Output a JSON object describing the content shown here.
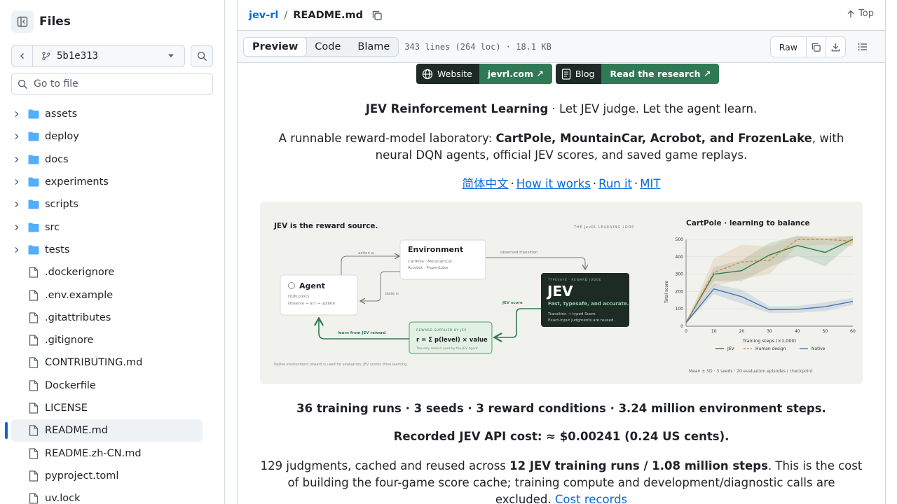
{
  "sidebar": {
    "title": "Files",
    "branch": "5b1e313",
    "goto_placeholder": "Go to file",
    "folders": [
      "assets",
      "deploy",
      "docs",
      "experiments",
      "scripts",
      "src",
      "tests"
    ],
    "files": [
      ".dockerignore",
      ".env.example",
      ".gitattributes",
      ".gitignore",
      "CONTRIBUTING.md",
      "Dockerfile",
      "LICENSE",
      "README.md",
      "README.zh-CN.md",
      "pyproject.toml",
      "uv.lock"
    ],
    "selected_file": "README.md"
  },
  "header": {
    "repo": "jev-rl",
    "separator": "/",
    "file": "README.md",
    "top_label": "Top"
  },
  "toolbar": {
    "tabs": [
      "Preview",
      "Code",
      "Blame"
    ],
    "active_tab": "Preview",
    "meta": "343 lines (264 loc) · 18.1 KB",
    "raw_label": "Raw"
  },
  "readme": {
    "badges": [
      {
        "label": "Website",
        "value": "jevrl.com ↗",
        "icon": "globe-icon"
      },
      {
        "label": "Blog",
        "value": "Read the research ↗",
        "icon": "document-icon"
      }
    ],
    "tagline_bold": "JEV Reinforcement Learning",
    "tagline_rest": " · Let JEV judge. Let the agent learn.",
    "intro_pre": "A runnable reward-model laboratory: ",
    "intro_bold": "CartPole, MountainCar, Acrobot, and FrozenLake",
    "intro_post": ", with neural DQN agents, official JEV scores, and saved game replays.",
    "links": [
      "简体中文",
      "How it works",
      "Run it",
      "MIT"
    ],
    "stats_line": "36 training runs · 3 seeds · 3 reward conditions · 3.24 million environment steps.",
    "cost_line": "Recorded JEV API cost: ≈ $0.00241 (0.24 US cents).",
    "cost_detail_pre": "129 judgments, cached and reused across ",
    "cost_detail_bold": "12 JEV training runs / 1.08 million steps",
    "cost_detail_post": ". This is the cost of building the four-game score cache; training compute and development/diagnostic calls are excluded. ",
    "cost_link": "Cost records"
  },
  "figure": {
    "left_title": "JEV is the reward source.",
    "loop_label": "THE JevRL LEARNING LOOP",
    "env_title": "Environment",
    "env_line1": "CartPole · MountainCar",
    "env_line2": "Acrobot · FrozenLake",
    "agent_title": "Agent",
    "agent_line1": "DQN policy",
    "agent_line2": "Observe → act → update",
    "jev_kicker": "TYPESAFE · REWARD JUDGE",
    "jev_title": "JEV",
    "jev_tagline": "Fast, typesafe, and accurate.",
    "jev_line1": "Transition → typed Score",
    "jev_line2": "Exact-input judgments are reused.",
    "reward_kicker": "REWARD SUPPLIED BY JEV",
    "reward_formula": "r = Σ p(level) × value",
    "reward_note": "The only reward used by the JEV agent.",
    "arrow_action": "action aₜ",
    "arrow_observed": "observed transition",
    "arrow_state": "state sₜ",
    "arrow_jev_score": "JEV score",
    "arrow_learn": "learn from JEV reward",
    "footnote": "Native environment reward is used for evaluation; JEV scores drive learning.",
    "chart_footnote": "Mean ± SD · 3 seeds · 20 evaluation episodes / checkpoint"
  },
  "chart_data": {
    "type": "line",
    "title": "CartPole · learning to balance",
    "xlabel": "Training steps (×1,000)",
    "ylabel": "Total score",
    "x": [
      0,
      10,
      20,
      30,
      40,
      50,
      60
    ],
    "xlim": [
      0,
      60
    ],
    "ylim": [
      0,
      500
    ],
    "yticks": [
      0,
      100,
      200,
      300,
      400,
      500
    ],
    "series": [
      {
        "name": "JEV",
        "color": "#2f7a4a",
        "dash": "solid",
        "values": [
          20,
          300,
          320,
          410,
          465,
          425,
          500
        ],
        "sd": [
          5,
          40,
          60,
          70,
          60,
          80,
          20
        ]
      },
      {
        "name": "Human design",
        "color": "#d08a4a",
        "dash": "dashed",
        "values": [
          20,
          310,
          370,
          380,
          500,
          500,
          490
        ],
        "sd": [
          5,
          80,
          100,
          80,
          40,
          30,
          30
        ]
      },
      {
        "name": "Native",
        "color": "#4a74b4",
        "dash": "solid",
        "values": [
          20,
          215,
          170,
          95,
          97,
          112,
          143
        ],
        "sd": [
          5,
          30,
          40,
          20,
          20,
          25,
          20
        ]
      }
    ],
    "legend": "bottom"
  }
}
